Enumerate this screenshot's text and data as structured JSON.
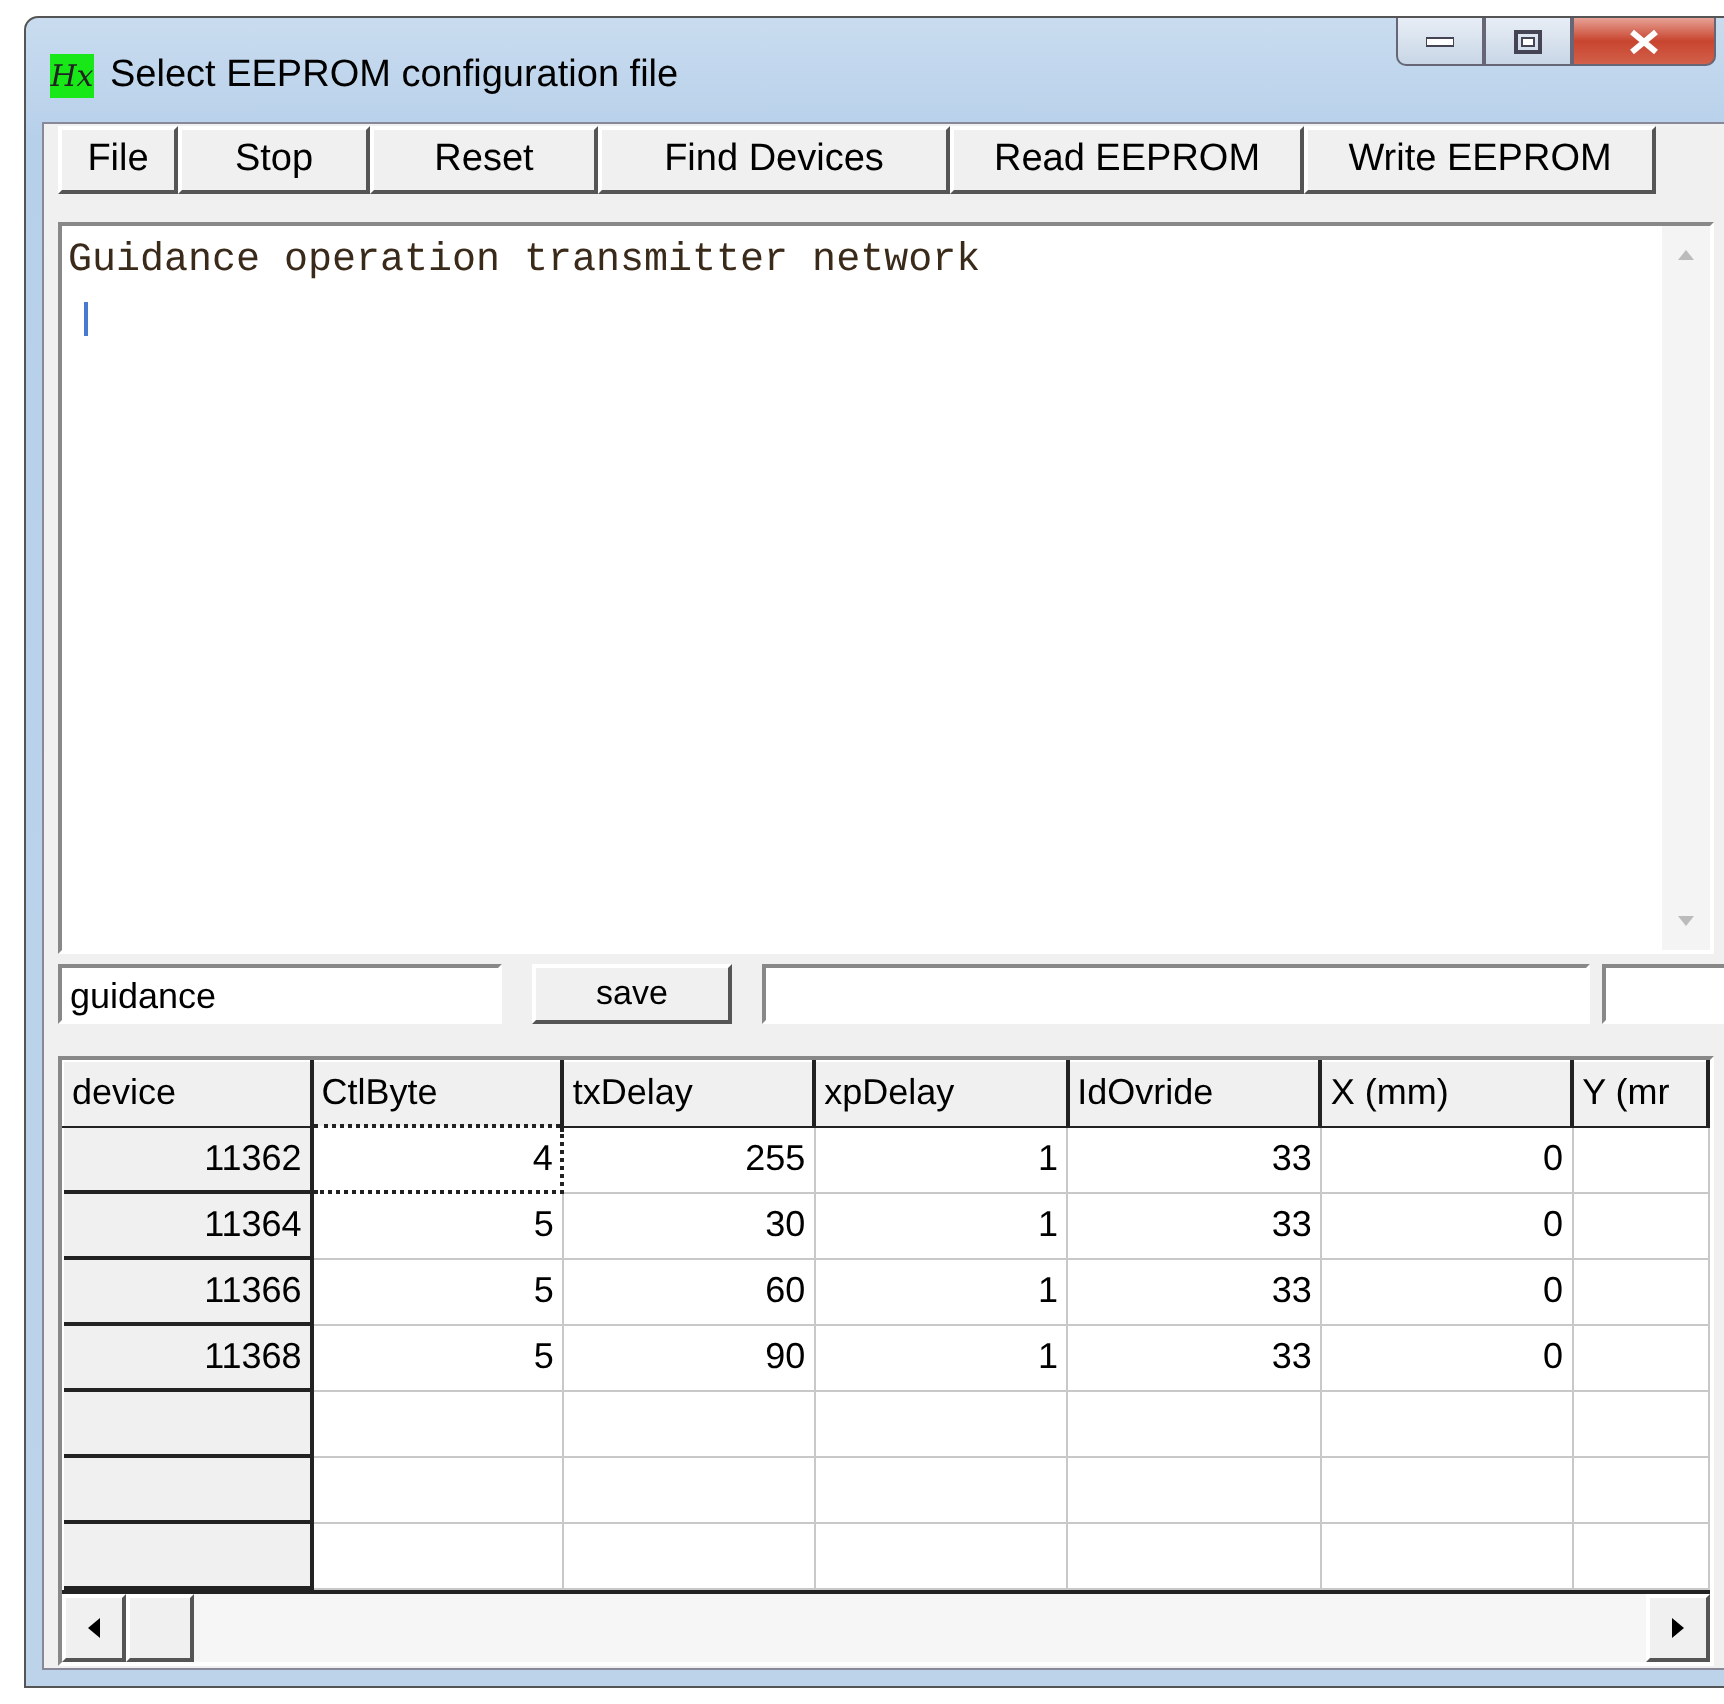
{
  "window": {
    "logo": "Hx",
    "title": "Select EEPROM configuration file"
  },
  "toolbar": [
    "File",
    "Stop",
    "Reset",
    "Find Devices",
    "Read EEPROM",
    "Write EEPROM"
  ],
  "output_text": "Guidance operation transmitter network",
  "name_field": {
    "value": "guidance"
  },
  "save_button": "save",
  "table": {
    "columns": [
      "device",
      "CtlByte",
      "txDelay",
      "xpDelay",
      "IdOvride",
      "X (mm)",
      "Y (mr"
    ],
    "rows": [
      {
        "cells": [
          {
            "text": "11362",
            "focused": false
          },
          {
            "text": "4",
            "focused": true
          },
          {
            "text": "255",
            "focused": false
          },
          {
            "text": "1",
            "focused": false
          },
          {
            "text": "33",
            "focused": false
          },
          {
            "text": "0",
            "focused": false
          }
        ]
      },
      {
        "cells": [
          {
            "text": "11364",
            "focused": false
          },
          {
            "text": "5",
            "focused": false
          },
          {
            "text": "30",
            "focused": false
          },
          {
            "text": "1",
            "focused": false
          },
          {
            "text": "33",
            "focused": false
          },
          {
            "text": "0",
            "focused": false
          }
        ]
      },
      {
        "cells": [
          {
            "text": "11366",
            "focused": false
          },
          {
            "text": "5",
            "focused": false
          },
          {
            "text": "60",
            "focused": false
          },
          {
            "text": "1",
            "focused": false
          },
          {
            "text": "33",
            "focused": false
          },
          {
            "text": "0",
            "focused": false
          }
        ]
      },
      {
        "cells": [
          {
            "text": "11368",
            "focused": false
          },
          {
            "text": "5",
            "focused": false
          },
          {
            "text": "90",
            "focused": false
          },
          {
            "text": "1",
            "focused": false
          },
          {
            "text": "33",
            "focused": false
          },
          {
            "text": "0",
            "focused": false
          }
        ]
      }
    ]
  }
}
